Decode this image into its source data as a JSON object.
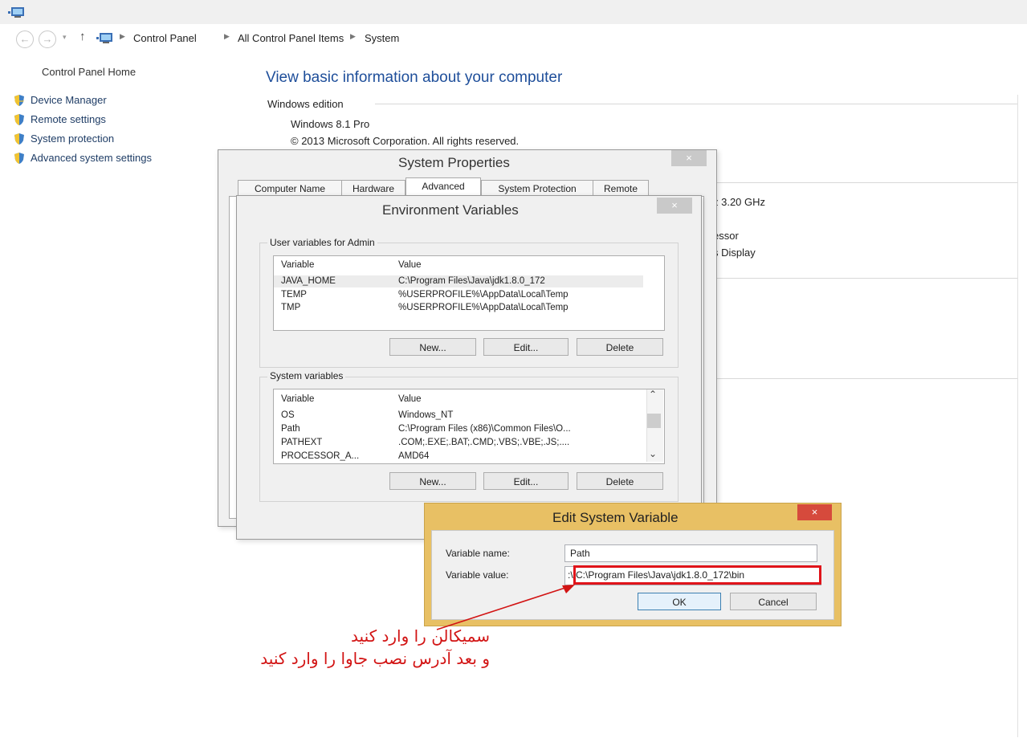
{
  "breadcrumb": {
    "items": [
      "Control Panel",
      "All Control Panel Items",
      "System"
    ]
  },
  "sidebar": {
    "home": "Control Panel Home",
    "links": [
      {
        "label": "Device Manager",
        "icon": "shield-icon"
      },
      {
        "label": "Remote settings",
        "icon": "shield-icon"
      },
      {
        "label": "System protection",
        "icon": "shield-icon"
      },
      {
        "label": "Advanced system settings",
        "icon": "shield-icon"
      }
    ]
  },
  "main": {
    "heading": "View basic information about your computer",
    "edition_section": "Windows edition",
    "edition": "Windows 8.1 Pro",
    "copyright": "© 2013 Microsoft Corporation. All rights reserved.",
    "speed_fragment": "z  3.20 GHz",
    "processor_fragment": "essor",
    "display_fragment": "s Display"
  },
  "system_properties": {
    "title": "System Properties",
    "close": "×",
    "tabs": [
      "Computer Name",
      "Hardware",
      "Advanced",
      "System Protection",
      "Remote"
    ],
    "active_tab": "Advanced"
  },
  "env_vars": {
    "title": "Environment Variables",
    "close": "×",
    "user_group": "User variables for Admin",
    "col_variable": "Variable",
    "col_value": "Value",
    "user_rows": [
      {
        "variable": "JAVA_HOME",
        "value": "C:\\Program Files\\Java\\jdk1.8.0_172"
      },
      {
        "variable": "TEMP",
        "value": "%USERPROFILE%\\AppData\\Local\\Temp"
      },
      {
        "variable": "TMP",
        "value": "%USERPROFILE%\\AppData\\Local\\Temp"
      }
    ],
    "system_group": "System variables",
    "system_rows": [
      {
        "variable": "OS",
        "value": "Windows_NT"
      },
      {
        "variable": "Path",
        "value": "C:\\Program Files (x86)\\Common Files\\O..."
      },
      {
        "variable": "PATHEXT",
        "value": ".COM;.EXE;.BAT;.CMD;.VBS;.VBE;.JS;...."
      },
      {
        "variable": "PROCESSOR_A...",
        "value": "AMD64"
      }
    ],
    "new_label": "New...",
    "edit_label": "Edit...",
    "delete_label": "Delete"
  },
  "edit_dialog": {
    "title": "Edit System Variable",
    "close": "×",
    "name_label": "Variable name:",
    "name_value": "Path",
    "value_label": "Variable value:",
    "value_value": ":\\;C:\\Program Files\\Java\\jdk1.8.0_172\\bin",
    "ok": "OK",
    "cancel": "Cancel",
    "accent": "#e8c064",
    "close_color": "#d64a3c"
  },
  "annotation": {
    "line1": "سمیکالن را وارد کنید",
    "line2": "و بعد آدرس نصب جاوا را وارد کنید",
    "color": "#d21414"
  }
}
